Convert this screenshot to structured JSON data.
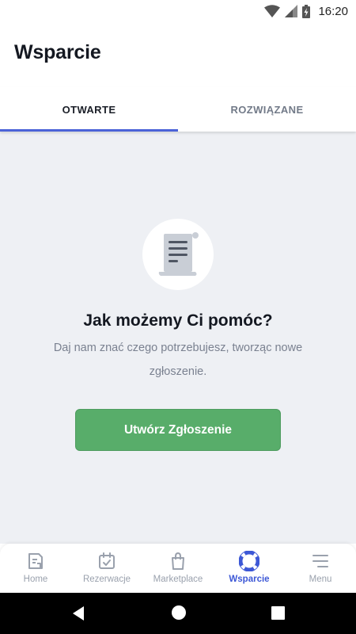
{
  "status_bar": {
    "time": "16:20"
  },
  "header": {
    "title": "Wsparcie"
  },
  "tabs": [
    {
      "label": "OTWARTE",
      "active": true
    },
    {
      "label": "ROZWIĄZANE",
      "active": false
    }
  ],
  "empty_state": {
    "icon": "document-scroll-icon",
    "title": "Jak możemy Ci pomóc?",
    "description": "Daj nam znać czego potrzebujesz, tworząc nowe zgłoszenie.",
    "button_label": "Utwórz Zgłoszenie"
  },
  "bottom_nav": {
    "items": [
      {
        "label": "Home",
        "icon": "home-icon"
      },
      {
        "label": "Rezerwacje",
        "icon": "calendar-icon"
      },
      {
        "label": "Marketplace",
        "icon": "shopping-bag-icon"
      },
      {
        "label": "Wsparcie",
        "icon": "lifebuoy-icon",
        "active": true
      },
      {
        "label": "Menu",
        "icon": "menu-icon"
      }
    ]
  },
  "colors": {
    "accent": "#4b63d8",
    "button_green": "#58ad6a",
    "content_bg": "#eef0f4"
  }
}
